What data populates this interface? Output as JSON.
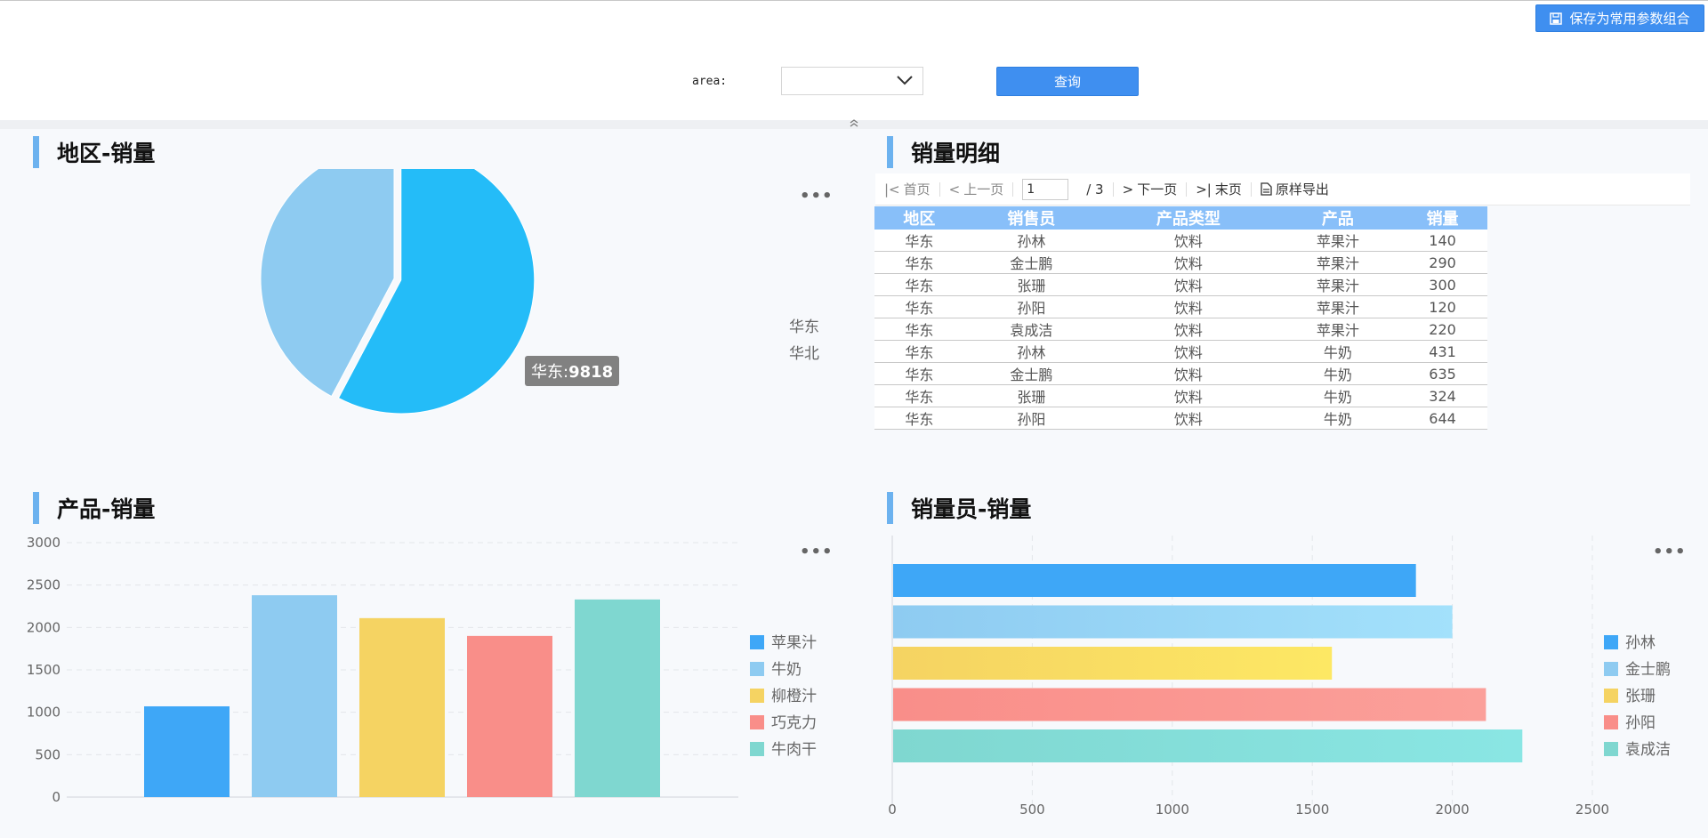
{
  "header": {
    "save_label": "保存为常用参数组合",
    "area_label": "area:",
    "area_value": "",
    "query_label": "查询"
  },
  "panels": {
    "region_sales_title": "地区-销量",
    "sales_detail_title": "销量明细",
    "product_sales_title": "产品-销量",
    "salesperson_sales_title": "销量员-销量",
    "more_label": "•••"
  },
  "pager": {
    "first": "首页",
    "prev": "上一页",
    "page_value": "1",
    "total": "/ 3",
    "next": "下一页",
    "last": "末页",
    "export": "原样导出"
  },
  "table": {
    "headers": [
      "地区",
      "销售员",
      "产品类型",
      "产品",
      "销量"
    ],
    "rows": [
      [
        "华东",
        "孙林",
        "饮料",
        "苹果汁",
        "140"
      ],
      [
        "华东",
        "金士鹏",
        "饮料",
        "苹果汁",
        "290"
      ],
      [
        "华东",
        "张珊",
        "饮料",
        "苹果汁",
        "300"
      ],
      [
        "华东",
        "孙阳",
        "饮料",
        "苹果汁",
        "120"
      ],
      [
        "华东",
        "袁成洁",
        "饮料",
        "苹果汁",
        "220"
      ],
      [
        "华东",
        "孙林",
        "饮料",
        "牛奶",
        "431"
      ],
      [
        "华东",
        "金士鹏",
        "饮料",
        "牛奶",
        "635"
      ],
      [
        "华东",
        "张珊",
        "饮料",
        "牛奶",
        "324"
      ],
      [
        "华东",
        "孙阳",
        "饮料",
        "牛奶",
        "644"
      ]
    ]
  },
  "colors": {
    "accent": "#3f8ff0",
    "header_blue": "#88bff9"
  },
  "chart_data": [
    {
      "type": "pie",
      "title": "地区-销量",
      "categories": [
        "华东",
        "华北"
      ],
      "values": [
        9818,
        7180
      ],
      "colors": [
        "#24bcf8",
        "#8ecbf1"
      ],
      "tooltip": {
        "label": "华东",
        "value": 9818
      },
      "legend": "right"
    },
    {
      "type": "bar",
      "title": "产品-销量",
      "categories": [
        "苹果汁",
        "牛奶",
        "柳橙汁",
        "巧克力",
        "牛肉干"
      ],
      "values": [
        1070,
        2380,
        2110,
        1900,
        2330
      ],
      "colors": [
        "#3ea7f7",
        "#8ecbf1",
        "#f5d362",
        "#f98e89",
        "#7fd7d0"
      ],
      "ylim": [
        0,
        3000
      ],
      "yticks": [
        0,
        500,
        1000,
        1500,
        2000,
        2500,
        3000
      ],
      "grid": true,
      "legend": "right"
    },
    {
      "type": "bar",
      "orientation": "horizontal",
      "title": "销量员-销量",
      "categories": [
        "孙林",
        "金士鹏",
        "张珊",
        "孙阳",
        "袁成洁"
      ],
      "values": [
        1870,
        2000,
        1570,
        2120,
        2250
      ],
      "colors": [
        [
          "#3ea7f7",
          "#3ea7f7"
        ],
        [
          "#8ecbf1",
          "#a3e1fb"
        ],
        [
          "#f5d362",
          "#fde864"
        ],
        [
          "#f98e89",
          "#fba09a"
        ],
        [
          "#7fd7d0",
          "#8ae6e4"
        ]
      ],
      "xlim": [
        0,
        2500
      ],
      "xticks": [
        0,
        500,
        1000,
        1500,
        2000,
        2500
      ],
      "grid": true,
      "legend": "right"
    }
  ]
}
